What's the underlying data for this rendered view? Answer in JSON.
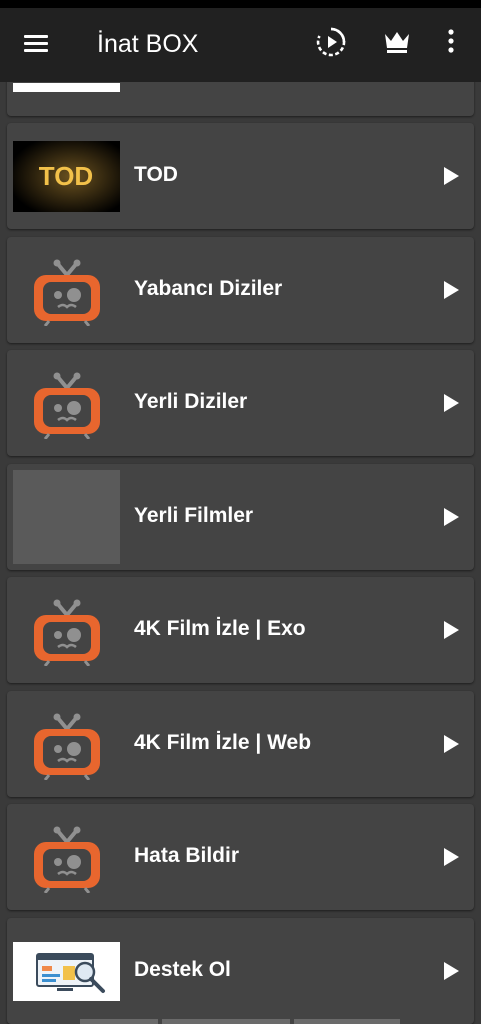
{
  "app": {
    "title": "İnat BOX"
  },
  "toolbar": {
    "menu_icon": "hamburger-menu-icon",
    "play_icon": "play-circle-icon",
    "crown_icon": "crown-icon",
    "more_icon": "more-vert-icon"
  },
  "colors": {
    "appbar": "#212121",
    "background": "#3a3a3a",
    "card": "#444444",
    "tv_orange": "#e8662e",
    "tv_gray": "#909090",
    "tod_gold": "#f2c14a"
  },
  "thumb_text": {
    "tod": "TOD"
  },
  "items": [
    {
      "label": "",
      "thumb": "white"
    },
    {
      "label": "TOD",
      "thumb": "tod-logo"
    },
    {
      "label": "Yabancı Diziler",
      "thumb": "tv-icon"
    },
    {
      "label": "Yerli Diziler",
      "thumb": "tv-icon"
    },
    {
      "label": "Yerli Filmler",
      "thumb": "gray"
    },
    {
      "label": "4K Film İzle | Exo",
      "thumb": "tv-icon"
    },
    {
      "label": "4K Film İzle | Web",
      "thumb": "tv-icon"
    },
    {
      "label": "Hata Bildir",
      "thumb": "tv-icon"
    },
    {
      "label": "Destek Ol",
      "thumb": "analytics-screen"
    }
  ]
}
